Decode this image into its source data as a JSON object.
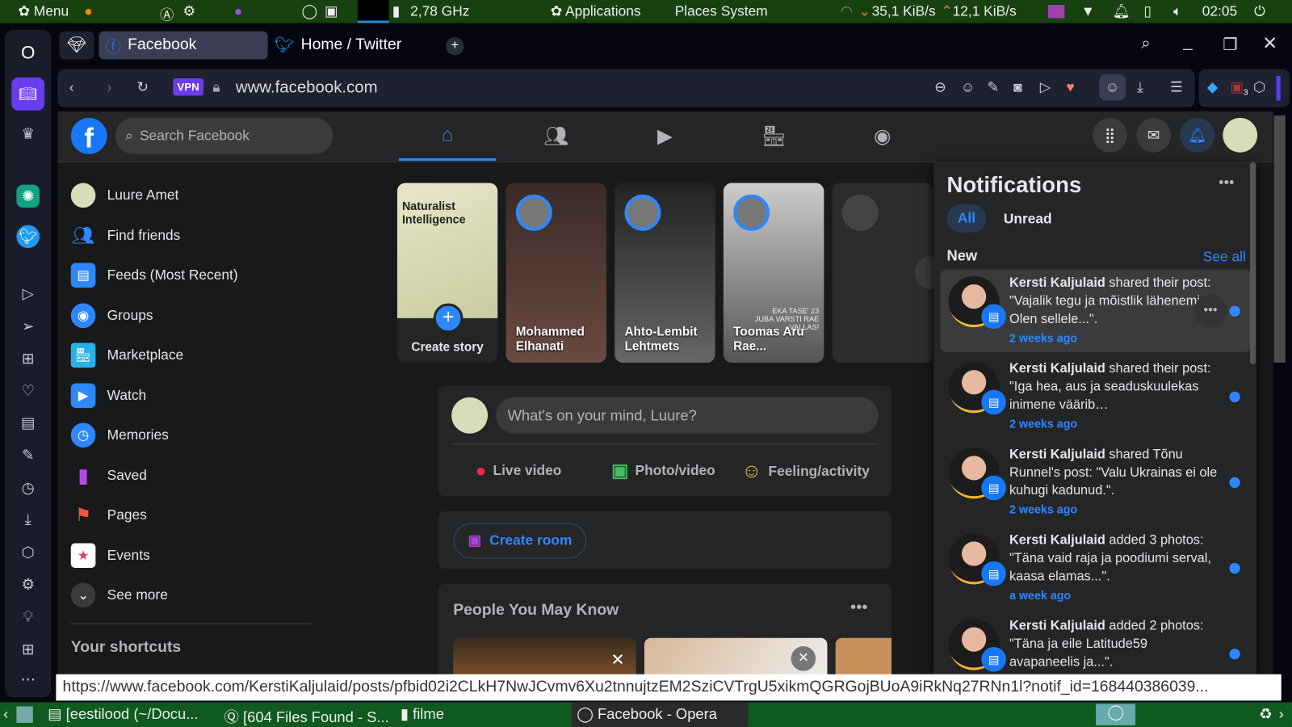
{
  "system_panel": {
    "menu": "Menu",
    "cpu": "2,78 GHz",
    "applications": "Applications",
    "places": "Places",
    "system": "System",
    "net_down": "35,1 KiB/s",
    "net_up": "12,1 KiB/s",
    "clock": "02:05"
  },
  "browser": {
    "tabs": [
      {
        "label": "Facebook",
        "active": true
      },
      {
        "label": "Home / Twitter",
        "active": false
      }
    ],
    "vpn": "VPN",
    "url": "www.facebook.com",
    "extension_badge": "3"
  },
  "facebook": {
    "search_placeholder": "Search Facebook",
    "left_nav": [
      {
        "label": "Luure Amet"
      },
      {
        "label": "Find friends"
      },
      {
        "label": "Feeds (Most Recent)"
      },
      {
        "label": "Groups"
      },
      {
        "label": "Marketplace"
      },
      {
        "label": "Watch"
      },
      {
        "label": "Memories"
      },
      {
        "label": "Saved"
      },
      {
        "label": "Pages"
      },
      {
        "label": "Events"
      },
      {
        "label": "See more"
      }
    ],
    "shortcuts_heading": "Your shortcuts",
    "stories": {
      "create": "Create story",
      "create_card_text": "Naturalist Intelligence",
      "items": [
        {
          "name": "Mohammed Elhanati"
        },
        {
          "name": "Ahto-Lembit Lehtmets"
        },
        {
          "name": "Toomas Aru Rae..."
        }
      ],
      "story_overlay": "EKA TASE' 23 JUBA VARSTI RAE VALLAS!"
    },
    "composer": {
      "placeholder": "What's on your mind, Luure?",
      "live": "Live video",
      "photo": "Photo/video",
      "feeling": "Feeling/activity"
    },
    "create_room": "Create room",
    "people_heading": "People You May Know",
    "notifications": {
      "title": "Notifications",
      "tab_all": "All",
      "tab_unread": "Unread",
      "section": "New",
      "see_all": "See all",
      "items": [
        {
          "actor": "Kersti Kaljulaid",
          "text": " shared their post: \"Vajalik tegu ja mõistlik lähenemine. Olen sellele...\".",
          "time": "2 weeks ago"
        },
        {
          "actor": "Kersti Kaljulaid",
          "text": " shared their post: \"Iga hea, aus ja seaduskuulekas inimene väärib…",
          "time": "2 weeks ago"
        },
        {
          "actor": "Kersti Kaljulaid",
          "text": " shared Tõnu Runnel's post: \"Valu Ukrainas ei ole kuhugi kadunud.\".",
          "time": "2 weeks ago"
        },
        {
          "actor": "Kersti Kaljulaid",
          "text": " added 3 photos: \"Täna vaid raja ja poodiumi serval, kaasa elamas...\".",
          "time": "a week ago"
        },
        {
          "actor": "Kersti Kaljulaid",
          "text": " added 2 photos: \"Täna ja eile Latitude59 avapaneelis ja...\".",
          "time": ""
        }
      ]
    }
  },
  "status_url": "https://www.facebook.com/KerstiKaljulaid/posts/pfbid02i2CLkH7NwJCvmv6Xu2tnnujtzEM2SziCVTrgU5xikmQGRGojBUoA9iRkNq27RNn1l?notif_id=168440386039...",
  "taskbar": {
    "items": [
      "[eestilood (~/Docu...",
      "[604 Files Found - S...",
      "filme",
      "Facebook - Opera"
    ]
  }
}
